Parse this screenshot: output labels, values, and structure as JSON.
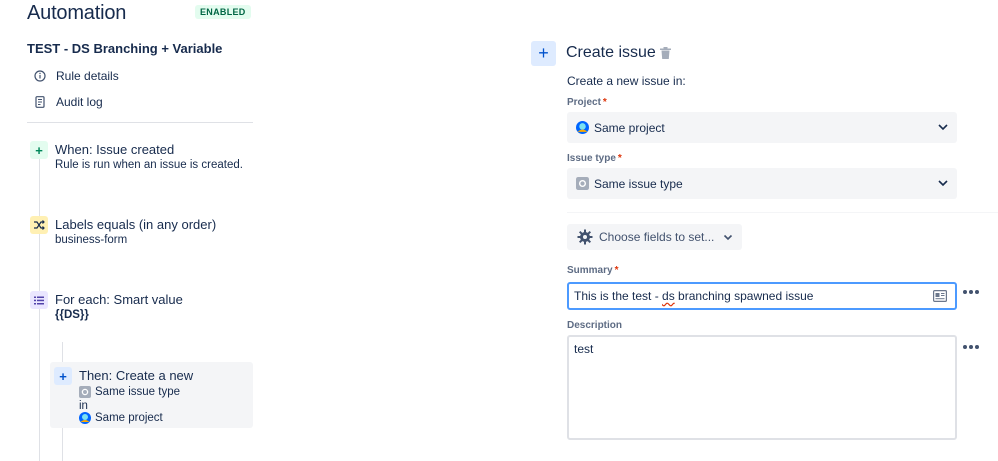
{
  "header": {
    "title": "Automation",
    "status_badge": "ENABLED"
  },
  "rule": {
    "name": "TEST - DS Branching + Variable"
  },
  "nav": [
    {
      "label": "Rule details",
      "icon": "info-icon"
    },
    {
      "label": "Audit log",
      "icon": "document-icon"
    }
  ],
  "steps": {
    "trigger": {
      "title": "When: Issue created",
      "subtitle": "Rule is run when an issue is created.",
      "icon": "plus-icon"
    },
    "condition": {
      "title": "Labels equals (in any order)",
      "subtitle": "business-form",
      "icon": "shuffle-icon"
    },
    "branch": {
      "title": "For each: Smart value",
      "subtitle": "{{DS}}",
      "icon": "list-icon"
    },
    "action": {
      "title": "Then: Create a new",
      "line1": "Same issue type",
      "line2": "in",
      "line3": "Same project",
      "icon": "plus-icon"
    }
  },
  "panel": {
    "title": "Create issue",
    "intro": "Create a new issue in:",
    "project": {
      "label": "Project",
      "value": "Same project"
    },
    "issue_type": {
      "label": "Issue type",
      "value": "Same issue type"
    },
    "choose_fields": "Choose fields to set...",
    "summary": {
      "label": "Summary",
      "value_before": "This is the test - ",
      "value_misspelled": "ds",
      "value_after": " branching spawned issue"
    },
    "description": {
      "label": "Description",
      "value": "test"
    }
  },
  "colors": {
    "accent": "#0052cc",
    "badge_bg": "#e3fcef",
    "badge_text": "#006644",
    "focus_border": "#4c9aff",
    "required": "#de350b"
  }
}
